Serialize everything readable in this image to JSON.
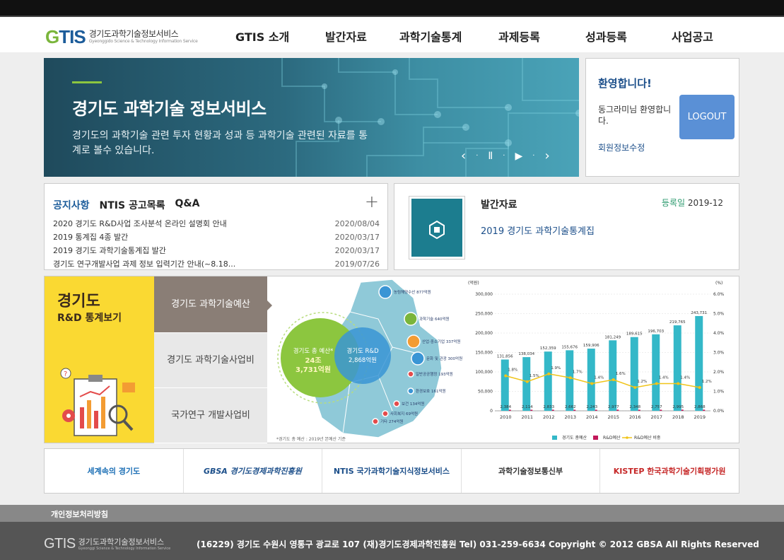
{
  "header": {
    "logo_mark_g": "G",
    "logo_mark_tis": "TIS",
    "logo_ko": "경기도과학기술정보서비스",
    "logo_en": "Gyeonggido Science & Technology Information Service",
    "nav": [
      "GTIS 소개",
      "발간자료",
      "과학기술통계",
      "과제등록",
      "성과등록",
      "사업공고"
    ]
  },
  "hero": {
    "title": "경기도 과학기술 정보서비스",
    "desc": "경기도의 과학기술 관련 투자 현황과 성과 등 과학기술 관련된 자료를 통계로 볼수 있습니다.",
    "prev": "‹",
    "pause": "Ⅱ",
    "play": "▶",
    "next": "›"
  },
  "welcome": {
    "title": "환영합니다!",
    "name": "동그라미님 환영합니다.",
    "logout": "LOGOUT",
    "edit": "회원정보수정"
  },
  "notice": {
    "tabs": [
      "공지사항",
      "NTIS 공고목록",
      "Q&A"
    ],
    "plus": "+",
    "items": [
      {
        "title": "2020 경기도 R&D사업 조사분석 온라인 설명회 안내",
        "date": "2020/08/04"
      },
      {
        "title": "2019 통계집 4종 발간",
        "date": "2020/03/17"
      },
      {
        "title": "2019 경기도 과학기술통계집 발간",
        "date": "2020/03/17"
      },
      {
        "title": "경기도 연구개발사업 과제 정보 입력기간 안내(~8.18...",
        "date": "2019/07/26"
      }
    ]
  },
  "publication": {
    "heading": "발간자료",
    "reg_label": "등록일",
    "reg_date": "2019-12",
    "title": "2019 경기도 과학기술통계집"
  },
  "rd": {
    "title": "경기도",
    "subtitle": "R&D 통계보기",
    "menu": [
      "경기도 과학기술예산",
      "경기도 과학기술사업비",
      "국가연구 개발사업비"
    ]
  },
  "map": {
    "total_label": "경기도 총 예산*",
    "total_value_1": "24조",
    "total_value_2": "3,731억원",
    "rd_label": "경기도 R&D",
    "rd_value": "2,868억원",
    "items": [
      "농림해양수산 877억원",
      "과학기술 640억원",
      "산업·중소기업 337억원",
      "문화 및 관광 300억원",
      "일반공공행정 193억원",
      "환경보호 161억원",
      "보건 134억원",
      "사회복지 69억원",
      "기타 274억원"
    ],
    "footnote": "*경기도 총 예산 : 2019년 본예산 기준"
  },
  "chart_data": {
    "type": "bar",
    "left_unit": "(억원)",
    "right_unit": "(%)",
    "categories": [
      "2010",
      "2011",
      "2012",
      "2013",
      "2014",
      "2015",
      "2016",
      "2017",
      "2018",
      "2019"
    ],
    "ylim": [
      0,
      300000
    ],
    "y2lim": [
      0,
      6.0
    ],
    "yticks": [
      "0",
      "50,000",
      "100,000",
      "150,000",
      "200,000",
      "250,000",
      "300,000"
    ],
    "y2ticks": [
      "0.0%",
      "1.0%",
      "2.0%",
      "3.0%",
      "4.0%",
      "5.0%",
      "6.0%"
    ],
    "series": [
      {
        "name": "경기도 총예산",
        "color": "#34b8c8",
        "values": [
          131856,
          138034,
          152359,
          155676,
          159906,
          181249,
          189615,
          196703,
          219765,
          243731
        ],
        "labels": [
          "131,856",
          "138,034",
          "152,359",
          "155,676",
          "159,906",
          "181,249",
          "189,615",
          "196,703",
          "219,765",
          "243,731"
        ]
      },
      {
        "name": "R&D예산",
        "color": "#c2185b",
        "values": [
          2384,
          2114,
          2833,
          2662,
          2243,
          2977,
          2348,
          2757,
          2995,
          2868
        ],
        "labels": [
          "2,384",
          "2,114",
          "2,833",
          "2,662",
          "2,243",
          "2,977",
          "2,348",
          "2,757",
          "2,995",
          "2,868"
        ]
      },
      {
        "name": "R&D예산 비중",
        "color": "#f0c419",
        "values": [
          1.8,
          1.5,
          1.9,
          1.7,
          1.4,
          1.6,
          1.2,
          1.4,
          1.4,
          1.2
        ],
        "labels": [
          "1.8%",
          "1.5%",
          "1.9%",
          "1.7%",
          "1.4%",
          "1.6%",
          "1.2%",
          "1.4%",
          "1.4%",
          "1.2%"
        ]
      }
    ]
  },
  "partners": [
    "세계속의 경기도",
    "GBSA 경기도경제과학진흥원",
    "NTIS 국가과학기술지식정보서비스",
    "과학기술정보통신부",
    "KISTEP 한국과학기술기획평가원"
  ],
  "footer": {
    "privacy": "개인정보처리방침",
    "logo": "GTIS",
    "logo_ko": "경기도과학기술정보서비스",
    "logo_en": "Gyeonggi Science & Technology Information Service",
    "address": "(16229) 경기도 수원시 영통구 광교로 107 (재)경기도경제과학진흥원 Tel) 031-259-6634 Copyright © 2012 GBSA All Rights Reserved"
  }
}
